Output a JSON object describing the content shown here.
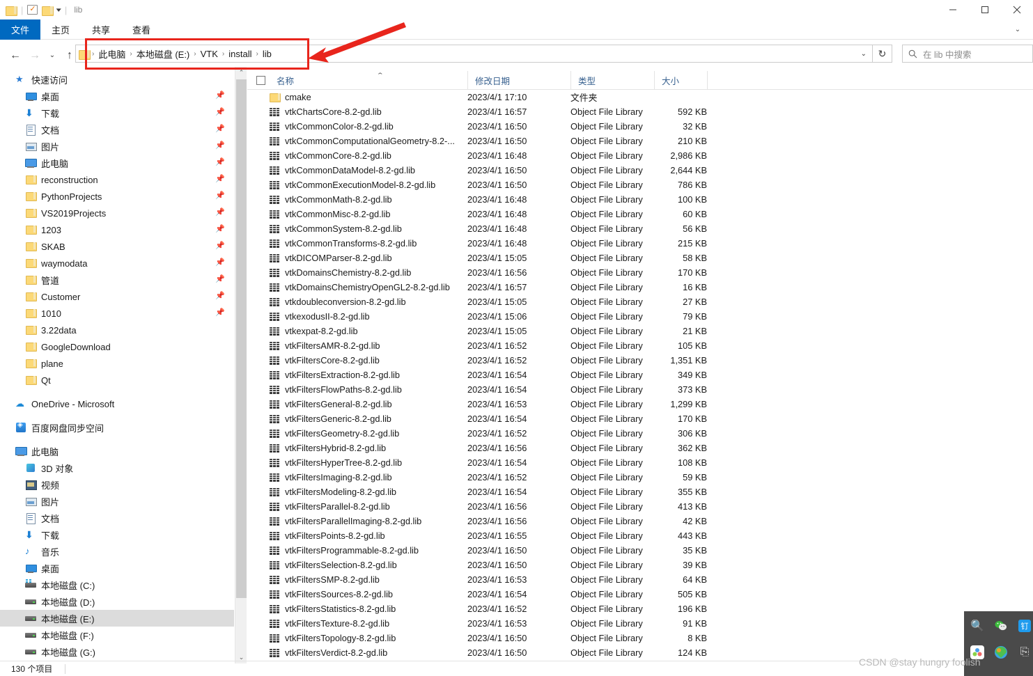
{
  "window": {
    "title": "lib",
    "quick_access": [
      "folder-icon",
      "properties-icon",
      "new-folder-icon",
      "dropdown-caret"
    ],
    "controls": {
      "minimize": "minimize-icon",
      "maximize": "maximize-icon",
      "close": "close-icon"
    }
  },
  "ribbon": {
    "tabs": [
      {
        "label": "文件",
        "active": true
      },
      {
        "label": "主页",
        "active": false
      },
      {
        "label": "共享",
        "active": false
      },
      {
        "label": "查看",
        "active": false
      }
    ],
    "expand": "chevron-down-icon"
  },
  "address": {
    "back": "back-arrow-icon",
    "forward": "forward-arrow-icon",
    "recent": "recent-locations-caret",
    "up": "up-arrow-icon",
    "breadcrumbs": [
      "此电脑",
      "本地磁盘 (E:)",
      "VTK",
      "install",
      "lib"
    ],
    "separator": "›",
    "dropdown": "chevron-down-icon",
    "refresh": "refresh-icon"
  },
  "search": {
    "placeholder": "在 lib 中搜索",
    "icon": "search-icon"
  },
  "sidebar": {
    "groups": [
      {
        "header": {
          "label": "快速访问",
          "icon": "star-pin-icon"
        },
        "items": [
          {
            "label": "桌面",
            "icon": "desktop-icon",
            "pinned": true
          },
          {
            "label": "下载",
            "icon": "download-icon",
            "pinned": true
          },
          {
            "label": "文档",
            "icon": "documents-icon",
            "pinned": true
          },
          {
            "label": "图片",
            "icon": "pictures-icon",
            "pinned": true
          },
          {
            "label": "此电脑",
            "icon": "this-pc-icon",
            "pinned": true
          },
          {
            "label": "reconstruction",
            "icon": "folder-icon",
            "pinned": true
          },
          {
            "label": "PythonProjects",
            "icon": "folder-icon",
            "pinned": true
          },
          {
            "label": "VS2019Projects",
            "icon": "folder-icon",
            "pinned": true
          },
          {
            "label": "1203",
            "icon": "folder-icon",
            "pinned": true
          },
          {
            "label": "SKAB",
            "icon": "folder-icon",
            "pinned": true
          },
          {
            "label": "waymodata",
            "icon": "folder-icon",
            "pinned": true
          },
          {
            "label": "管道",
            "icon": "folder-icon",
            "pinned": true
          },
          {
            "label": "Customer",
            "icon": "folder-icon",
            "pinned": true
          },
          {
            "label": "1010",
            "icon": "folder-icon",
            "pinned": true
          },
          {
            "label": "3.22data",
            "icon": "folder-icon",
            "pinned": false
          },
          {
            "label": "GoogleDownload",
            "icon": "folder-icon",
            "pinned": false
          },
          {
            "label": "plane",
            "icon": "folder-icon",
            "pinned": false
          },
          {
            "label": "Qt",
            "icon": "folder-icon",
            "pinned": false
          }
        ]
      },
      {
        "header": {
          "label": "OneDrive - Microsoft",
          "icon": "onedrive-icon"
        },
        "items": []
      },
      {
        "header": {
          "label": "百度网盘同步空间",
          "icon": "baidu-netdisk-icon"
        },
        "items": []
      },
      {
        "header": {
          "label": "此电脑",
          "icon": "this-pc-icon"
        },
        "items": [
          {
            "label": "3D 对象",
            "icon": "3d-objects-icon",
            "pinned": false
          },
          {
            "label": "视频",
            "icon": "videos-icon",
            "pinned": false
          },
          {
            "label": "图片",
            "icon": "pictures-icon",
            "pinned": false
          },
          {
            "label": "文档",
            "icon": "documents-icon",
            "pinned": false
          },
          {
            "label": "下载",
            "icon": "download-icon",
            "pinned": false
          },
          {
            "label": "音乐",
            "icon": "music-icon",
            "pinned": false
          },
          {
            "label": "桌面",
            "icon": "desktop-icon",
            "pinned": false
          },
          {
            "label": "本地磁盘 (C:)",
            "icon": "system-drive-icon",
            "pinned": false
          },
          {
            "label": "本地磁盘 (D:)",
            "icon": "drive-icon",
            "pinned": false
          },
          {
            "label": "本地磁盘 (E:)",
            "icon": "drive-icon",
            "pinned": false,
            "selected": true
          },
          {
            "label": "本地磁盘 (F:)",
            "icon": "drive-icon",
            "pinned": false
          },
          {
            "label": "本地磁盘 (G:)",
            "icon": "drive-icon",
            "pinned": false
          }
        ]
      }
    ],
    "scroll": {
      "up": "scroll-up-arrow",
      "down": "scroll-down-arrow"
    }
  },
  "filelist": {
    "columns": [
      {
        "label": "名称",
        "sorted": "asc"
      },
      {
        "label": "修改日期"
      },
      {
        "label": "类型"
      },
      {
        "label": "大小"
      }
    ],
    "select_all_checkbox": false,
    "rows": [
      {
        "name": "cmake",
        "date": "2023/4/1 17:10",
        "type": "文件夹",
        "size": "",
        "icon": "folder-icon"
      },
      {
        "name": "vtkChartsCore-8.2-gd.lib",
        "date": "2023/4/1 16:57",
        "type": "Object File Library",
        "size": "592 KB",
        "icon": "library-file-icon"
      },
      {
        "name": "vtkCommonColor-8.2-gd.lib",
        "date": "2023/4/1 16:50",
        "type": "Object File Library",
        "size": "32 KB",
        "icon": "library-file-icon"
      },
      {
        "name": "vtkCommonComputationalGeometry-8.2-...",
        "date": "2023/4/1 16:50",
        "type": "Object File Library",
        "size": "210 KB",
        "icon": "library-file-icon"
      },
      {
        "name": "vtkCommonCore-8.2-gd.lib",
        "date": "2023/4/1 16:48",
        "type": "Object File Library",
        "size": "2,986 KB",
        "icon": "library-file-icon"
      },
      {
        "name": "vtkCommonDataModel-8.2-gd.lib",
        "date": "2023/4/1 16:50",
        "type": "Object File Library",
        "size": "2,644 KB",
        "icon": "library-file-icon"
      },
      {
        "name": "vtkCommonExecutionModel-8.2-gd.lib",
        "date": "2023/4/1 16:50",
        "type": "Object File Library",
        "size": "786 KB",
        "icon": "library-file-icon"
      },
      {
        "name": "vtkCommonMath-8.2-gd.lib",
        "date": "2023/4/1 16:48",
        "type": "Object File Library",
        "size": "100 KB",
        "icon": "library-file-icon"
      },
      {
        "name": "vtkCommonMisc-8.2-gd.lib",
        "date": "2023/4/1 16:48",
        "type": "Object File Library",
        "size": "60 KB",
        "icon": "library-file-icon"
      },
      {
        "name": "vtkCommonSystem-8.2-gd.lib",
        "date": "2023/4/1 16:48",
        "type": "Object File Library",
        "size": "56 KB",
        "icon": "library-file-icon"
      },
      {
        "name": "vtkCommonTransforms-8.2-gd.lib",
        "date": "2023/4/1 16:48",
        "type": "Object File Library",
        "size": "215 KB",
        "icon": "library-file-icon"
      },
      {
        "name": "vtkDICOMParser-8.2-gd.lib",
        "date": "2023/4/1 15:05",
        "type": "Object File Library",
        "size": "58 KB",
        "icon": "library-file-icon"
      },
      {
        "name": "vtkDomainsChemistry-8.2-gd.lib",
        "date": "2023/4/1 16:56",
        "type": "Object File Library",
        "size": "170 KB",
        "icon": "library-file-icon"
      },
      {
        "name": "vtkDomainsChemistryOpenGL2-8.2-gd.lib",
        "date": "2023/4/1 16:57",
        "type": "Object File Library",
        "size": "16 KB",
        "icon": "library-file-icon"
      },
      {
        "name": "vtkdoubleconversion-8.2-gd.lib",
        "date": "2023/4/1 15:05",
        "type": "Object File Library",
        "size": "27 KB",
        "icon": "library-file-icon"
      },
      {
        "name": "vtkexodusII-8.2-gd.lib",
        "date": "2023/4/1 15:06",
        "type": "Object File Library",
        "size": "79 KB",
        "icon": "library-file-icon"
      },
      {
        "name": "vtkexpat-8.2-gd.lib",
        "date": "2023/4/1 15:05",
        "type": "Object File Library",
        "size": "21 KB",
        "icon": "library-file-icon"
      },
      {
        "name": "vtkFiltersAMR-8.2-gd.lib",
        "date": "2023/4/1 16:52",
        "type": "Object File Library",
        "size": "105 KB",
        "icon": "library-file-icon"
      },
      {
        "name": "vtkFiltersCore-8.2-gd.lib",
        "date": "2023/4/1 16:52",
        "type": "Object File Library",
        "size": "1,351 KB",
        "icon": "library-file-icon"
      },
      {
        "name": "vtkFiltersExtraction-8.2-gd.lib",
        "date": "2023/4/1 16:54",
        "type": "Object File Library",
        "size": "349 KB",
        "icon": "library-file-icon"
      },
      {
        "name": "vtkFiltersFlowPaths-8.2-gd.lib",
        "date": "2023/4/1 16:54",
        "type": "Object File Library",
        "size": "373 KB",
        "icon": "library-file-icon"
      },
      {
        "name": "vtkFiltersGeneral-8.2-gd.lib",
        "date": "2023/4/1 16:53",
        "type": "Object File Library",
        "size": "1,299 KB",
        "icon": "library-file-icon"
      },
      {
        "name": "vtkFiltersGeneric-8.2-gd.lib",
        "date": "2023/4/1 16:54",
        "type": "Object File Library",
        "size": "170 KB",
        "icon": "library-file-icon"
      },
      {
        "name": "vtkFiltersGeometry-8.2-gd.lib",
        "date": "2023/4/1 16:52",
        "type": "Object File Library",
        "size": "306 KB",
        "icon": "library-file-icon"
      },
      {
        "name": "vtkFiltersHybrid-8.2-gd.lib",
        "date": "2023/4/1 16:56",
        "type": "Object File Library",
        "size": "362 KB",
        "icon": "library-file-icon"
      },
      {
        "name": "vtkFiltersHyperTree-8.2-gd.lib",
        "date": "2023/4/1 16:54",
        "type": "Object File Library",
        "size": "108 KB",
        "icon": "library-file-icon"
      },
      {
        "name": "vtkFiltersImaging-8.2-gd.lib",
        "date": "2023/4/1 16:52",
        "type": "Object File Library",
        "size": "59 KB",
        "icon": "library-file-icon"
      },
      {
        "name": "vtkFiltersModeling-8.2-gd.lib",
        "date": "2023/4/1 16:54",
        "type": "Object File Library",
        "size": "355 KB",
        "icon": "library-file-icon"
      },
      {
        "name": "vtkFiltersParallel-8.2-gd.lib",
        "date": "2023/4/1 16:56",
        "type": "Object File Library",
        "size": "413 KB",
        "icon": "library-file-icon"
      },
      {
        "name": "vtkFiltersParallelImaging-8.2-gd.lib",
        "date": "2023/4/1 16:56",
        "type": "Object File Library",
        "size": "42 KB",
        "icon": "library-file-icon"
      },
      {
        "name": "vtkFiltersPoints-8.2-gd.lib",
        "date": "2023/4/1 16:55",
        "type": "Object File Library",
        "size": "443 KB",
        "icon": "library-file-icon"
      },
      {
        "name": "vtkFiltersProgrammable-8.2-gd.lib",
        "date": "2023/4/1 16:50",
        "type": "Object File Library",
        "size": "35 KB",
        "icon": "library-file-icon"
      },
      {
        "name": "vtkFiltersSelection-8.2-gd.lib",
        "date": "2023/4/1 16:50",
        "type": "Object File Library",
        "size": "39 KB",
        "icon": "library-file-icon"
      },
      {
        "name": "vtkFiltersSMP-8.2-gd.lib",
        "date": "2023/4/1 16:53",
        "type": "Object File Library",
        "size": "64 KB",
        "icon": "library-file-icon"
      },
      {
        "name": "vtkFiltersSources-8.2-gd.lib",
        "date": "2023/4/1 16:54",
        "type": "Object File Library",
        "size": "505 KB",
        "icon": "library-file-icon"
      },
      {
        "name": "vtkFiltersStatistics-8.2-gd.lib",
        "date": "2023/4/1 16:52",
        "type": "Object File Library",
        "size": "196 KB",
        "icon": "library-file-icon"
      },
      {
        "name": "vtkFiltersTexture-8.2-gd.lib",
        "date": "2023/4/1 16:53",
        "type": "Object File Library",
        "size": "91 KB",
        "icon": "library-file-icon"
      },
      {
        "name": "vtkFiltersTopology-8.2-gd.lib",
        "date": "2023/4/1 16:50",
        "type": "Object File Library",
        "size": "8 KB",
        "icon": "library-file-icon"
      },
      {
        "name": "vtkFiltersVerdict-8.2-gd.lib",
        "date": "2023/4/1 16:50",
        "type": "Object File Library",
        "size": "124 KB",
        "icon": "library-file-icon"
      }
    ]
  },
  "statusbar": {
    "item_count": "130 个项目"
  },
  "annotations": {
    "highlight_color": "#e8251c",
    "arrow": "red-arrow-pointing-to-address-bar"
  },
  "watermark": {
    "text": "CSDN @stay hungry foolish"
  },
  "overlay": {
    "icons": [
      "search-icon",
      "wechat-icon",
      "app-icon-blue",
      "cloud-sync-icon",
      "download-manager-icon",
      "copy-icon"
    ]
  },
  "colors": {
    "accent": "#0069c0",
    "selection": "#dcdcdc",
    "header_text": "#38618f",
    "folder": "#fcd977"
  }
}
